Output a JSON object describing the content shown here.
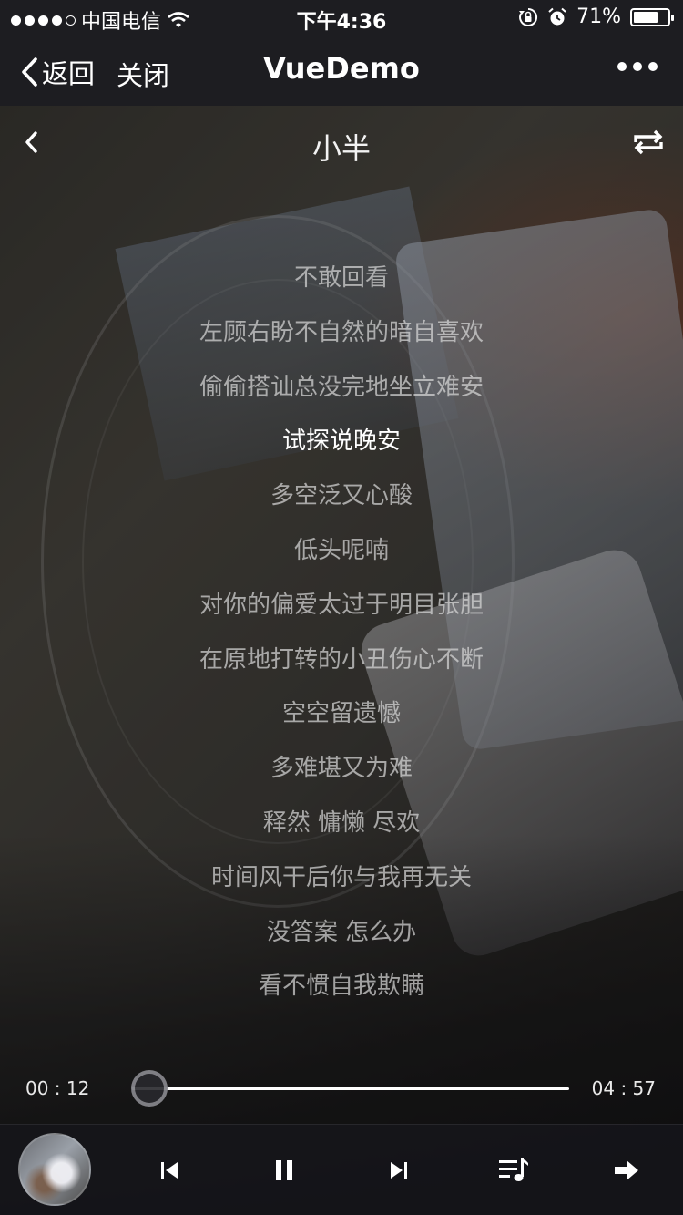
{
  "status_bar": {
    "carrier": "中国电信",
    "time": "下午4:36",
    "battery": "71%",
    "battery_level": 0.71,
    "icons": [
      "signal-dots",
      "wifi-icon",
      "rotation-lock-icon",
      "alarm-icon",
      "battery-icon"
    ]
  },
  "nav": {
    "back_label": "返回",
    "close_label": "关闭",
    "title": "VueDemo",
    "more_icon": "more-icon"
  },
  "player": {
    "song_title": "小半",
    "back_icon": "chevron-left-icon",
    "mode_icon": "repeat-icon"
  },
  "lyrics": {
    "active_index": 3,
    "lines": [
      "不敢回看",
      "左顾右盼不自然的暗自喜欢",
      "偷偷搭讪总没完地坐立难安",
      "试探说晚安",
      "多空泛又心酸",
      "低头呢喃",
      "对你的偏爱太过于明目张胆",
      "在原地打转的小丑伤心不断",
      "空空留遗憾",
      "多难堪又为难",
      "释然 慵懒 尽欢",
      "时间风干后你与我再无关",
      "没答案 怎么办",
      "看不惯自我欺瞒"
    ]
  },
  "progress": {
    "current": "00 : 12",
    "total": "04 : 57",
    "fraction": 0.04
  },
  "controls": {
    "icons": [
      "album-cover",
      "skip-previous-icon",
      "pause-icon",
      "skip-next-icon",
      "playlist-icon",
      "next-arrow-icon"
    ]
  }
}
